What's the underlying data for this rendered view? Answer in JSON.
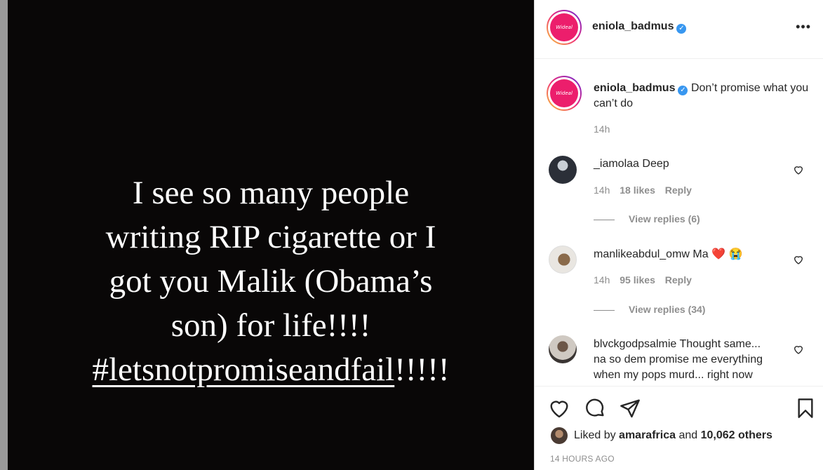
{
  "post": {
    "lines": [
      "I see so many people",
      "writing RIP cigarette or I",
      "got you Malik (Obama’s",
      "son) for life!!!!"
    ],
    "hashtag": "#letsnotpromiseandfail",
    "hashtag_suffix": "!!!!!"
  },
  "header": {
    "username": "eniola_badmus",
    "verified_glyph": "✓",
    "more_label": "•••",
    "avatar_text": "Wideal"
  },
  "caption": {
    "username": "eniola_badmus",
    "text": "Don’t promise what you can’t do",
    "time": "14h"
  },
  "comments": [
    {
      "username": "_iamolaa",
      "text": "Deep",
      "time": "14h",
      "likes": "18 likes",
      "reply": "Reply",
      "view_replies": "View replies (6)"
    },
    {
      "username": "manlikeabdul_omw",
      "text": "Ma",
      "emoji": "❤️ 😭",
      "time": "14h",
      "likes": "95 likes",
      "reply": "Reply",
      "view_replies": "View replies (34)"
    },
    {
      "username": "blvckgodpsalmie",
      "text_line1": "Thought same...",
      "text_line2": "na so dem promise me everything",
      "text_line3": "when my pops murd... right now"
    }
  ],
  "footer": {
    "liked_by_prefix": "Liked by",
    "liked_by_user": "amarafrica",
    "liked_by_and": "and",
    "liked_by_others": "10,062 others",
    "timestamp": "14 HOURS AGO"
  },
  "icons": [
    "heart-icon",
    "comment-icon",
    "share-icon",
    "bookmark-icon",
    "verified-icon",
    "more-icon"
  ],
  "colors": {
    "verified": "#3897f0",
    "avatar_brand": "#ec1e6c",
    "media_bg": "#090707"
  }
}
